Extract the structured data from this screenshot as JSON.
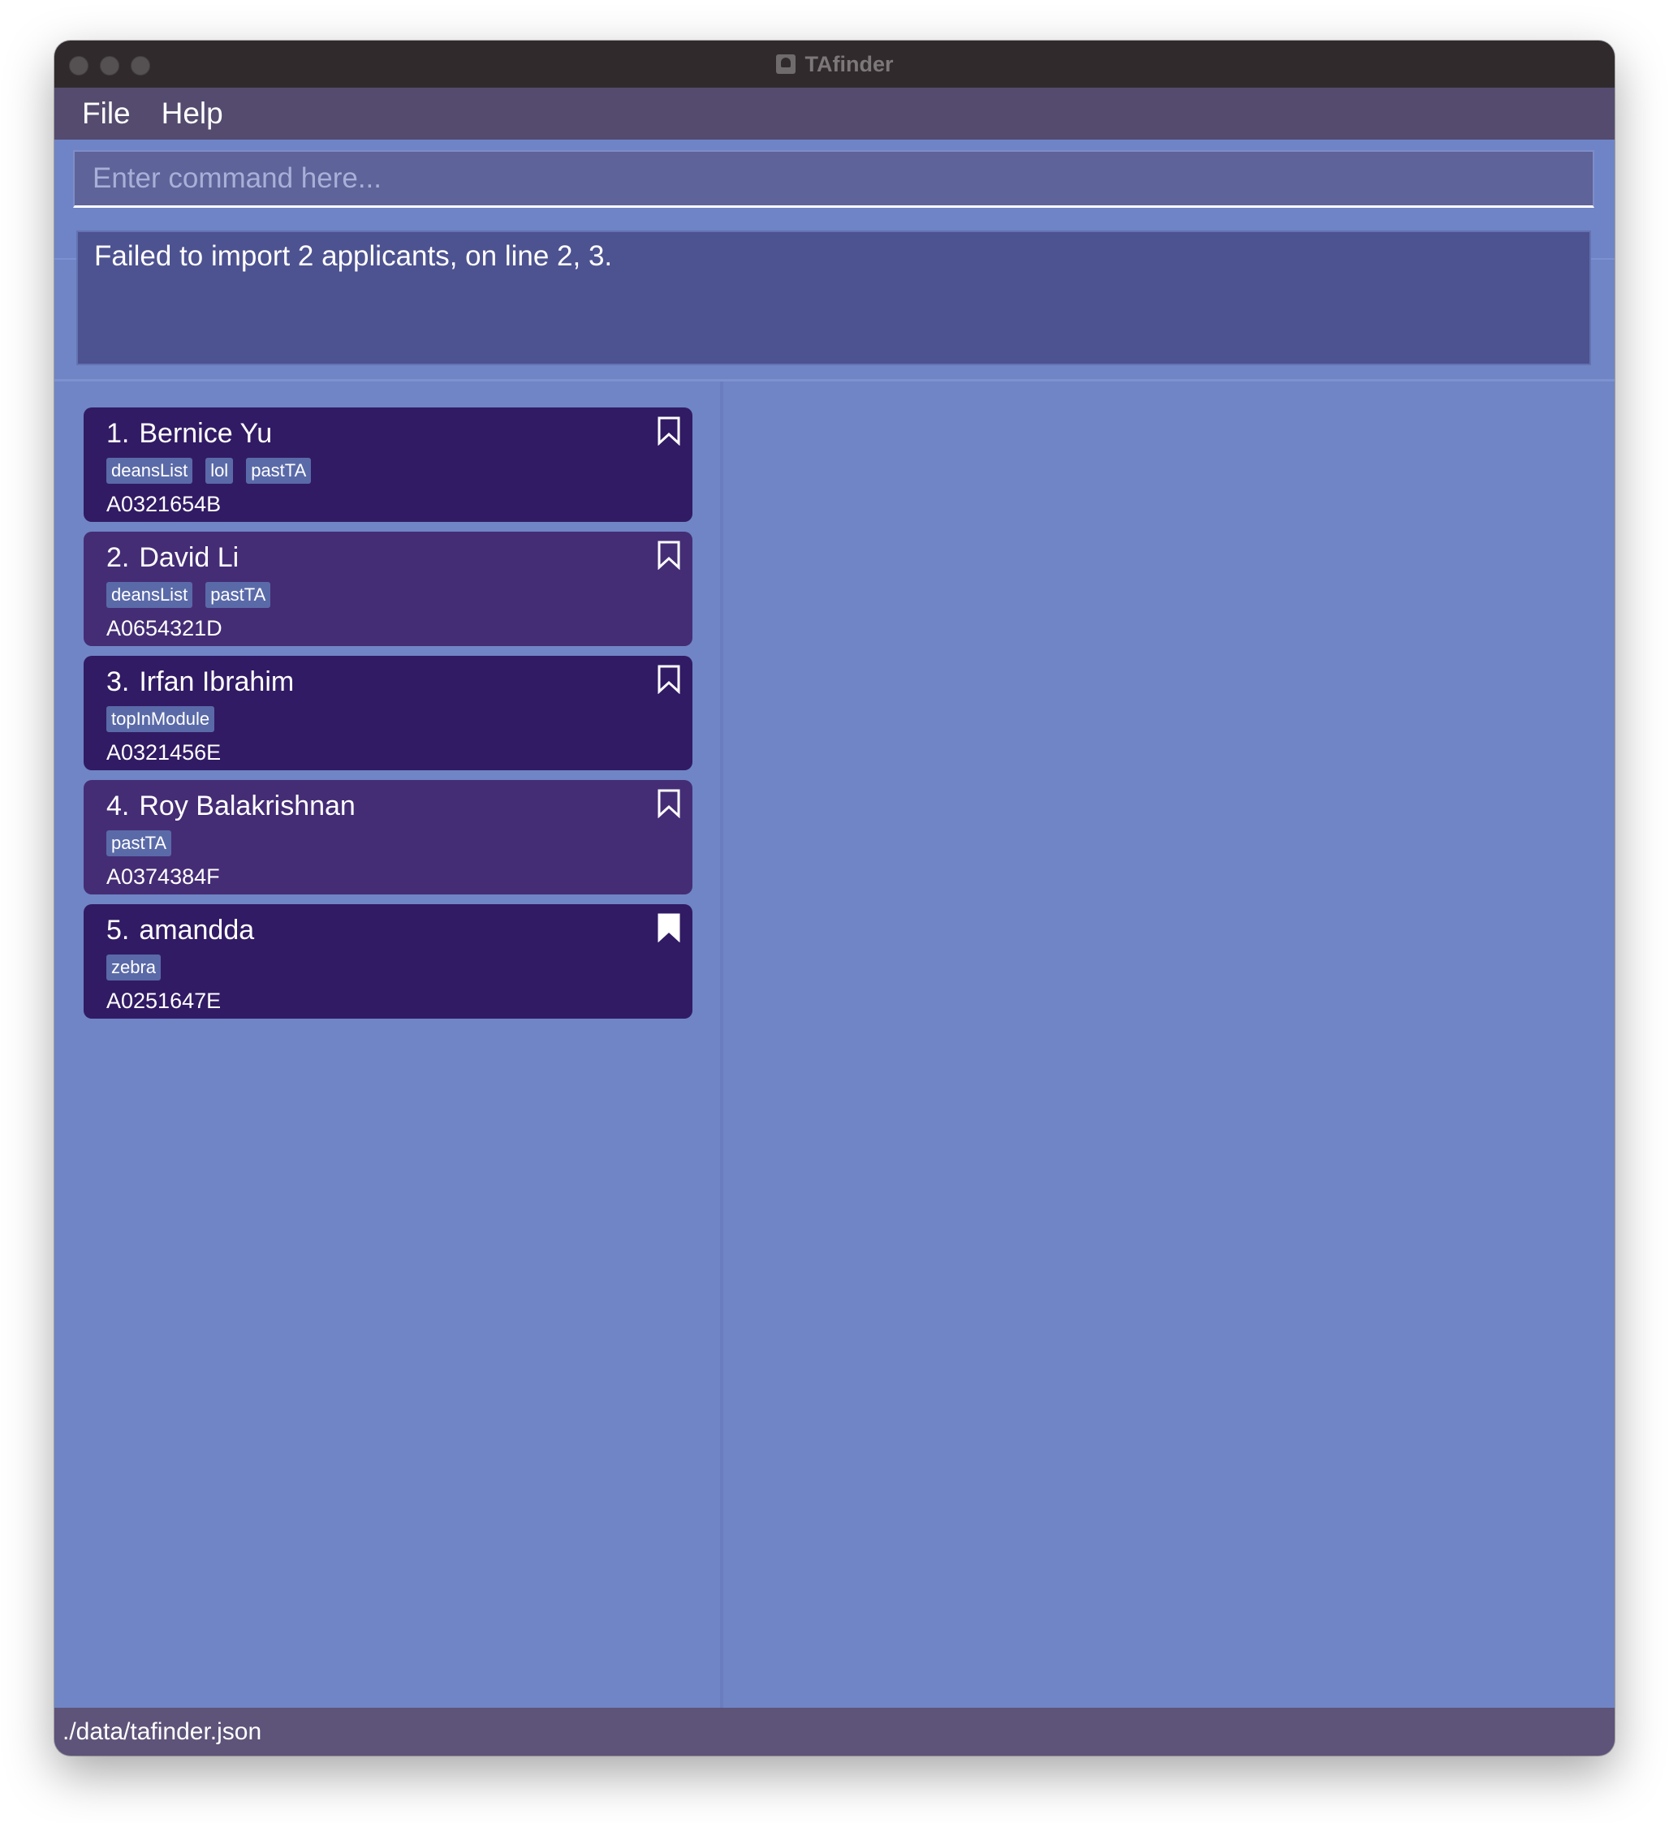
{
  "window": {
    "title": "TAfinder"
  },
  "menu": {
    "items": [
      "File",
      "Help"
    ]
  },
  "command": {
    "placeholder": "Enter command here...",
    "value": ""
  },
  "result": {
    "message": "Failed to import 2 applicants, on line 2, 3."
  },
  "applicants": [
    {
      "index": "1.",
      "name": "Bernice Yu",
      "tags": [
        "deansList",
        "lol",
        "pastTA"
      ],
      "id": "A0321654B",
      "bookmarked": false
    },
    {
      "index": "2.",
      "name": "David Li",
      "tags": [
        "deansList",
        "pastTA"
      ],
      "id": "A0654321D",
      "bookmarked": false
    },
    {
      "index": "3.",
      "name": "Irfan Ibrahim",
      "tags": [
        "topInModule"
      ],
      "id": "A0321456E",
      "bookmarked": false
    },
    {
      "index": "4.",
      "name": "Roy Balakrishnan",
      "tags": [
        "pastTA"
      ],
      "id": "A0374384F",
      "bookmarked": false
    },
    {
      "index": "5.",
      "name": "amandda",
      "tags": [
        "zebra"
      ],
      "id": "A0251647E",
      "bookmarked": true
    }
  ],
  "status": {
    "file_path": "./data/tafinder.json"
  },
  "colors": {
    "background": "#7085c5",
    "card_odd": "#311b64",
    "card_even": "#442d75",
    "menubar": "#544b6e",
    "statusbar": "#5e5379"
  }
}
